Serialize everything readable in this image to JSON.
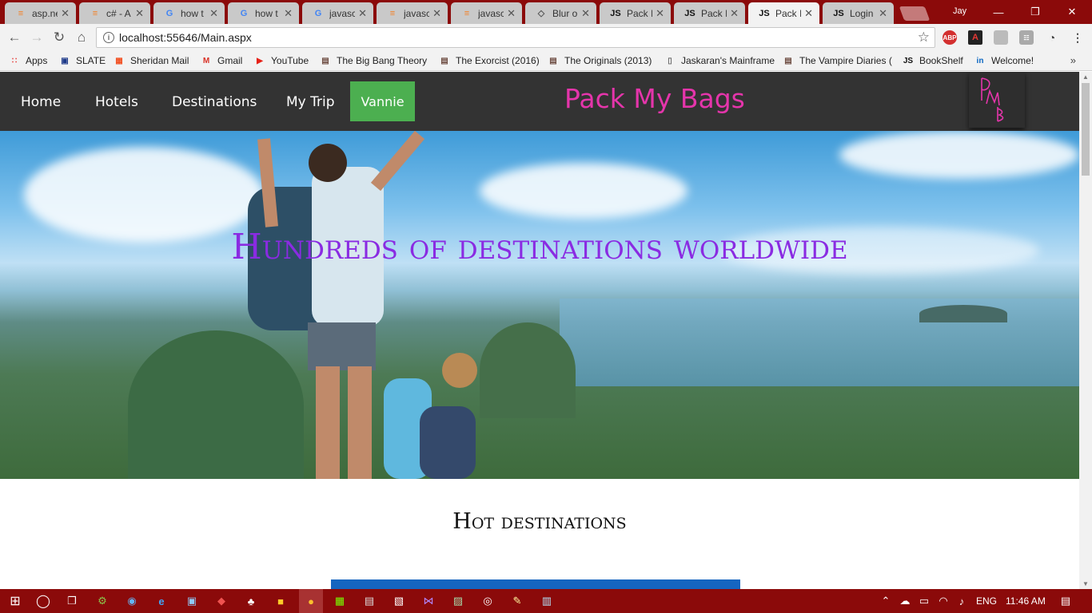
{
  "browser": {
    "tabs": [
      {
        "title": "asp.ne",
        "icon": "stackoverflow-icon"
      },
      {
        "title": "c# - A",
        "icon": "stackoverflow-icon"
      },
      {
        "title": "how t",
        "icon": "google-icon"
      },
      {
        "title": "how t",
        "icon": "google-icon"
      },
      {
        "title": "javasc",
        "icon": "google-icon"
      },
      {
        "title": "javasc",
        "icon": "stackoverflow-icon"
      },
      {
        "title": "javasc",
        "icon": "stackoverflow-icon"
      },
      {
        "title": "Blur o",
        "icon": "codepen-icon"
      },
      {
        "title": "Pack I",
        "icon": "js-icon"
      },
      {
        "title": "Pack I",
        "icon": "js-icon"
      },
      {
        "title": "Pack I",
        "icon": "js-icon"
      },
      {
        "title": "Login",
        "icon": "js-icon"
      }
    ],
    "active_tab_index": 10,
    "user": "Jay",
    "address": "localhost:55646/Main.aspx",
    "bookmarks": [
      {
        "label": "Apps",
        "icon": "apps-icon"
      },
      {
        "label": "SLATE",
        "icon": "slate-icon"
      },
      {
        "label": "Sheridan Mail",
        "icon": "microsoft-icon"
      },
      {
        "label": "Gmail",
        "icon": "gmail-icon"
      },
      {
        "label": "YouTube",
        "icon": "youtube-icon"
      },
      {
        "label": "The Big Bang Theory",
        "icon": "film-icon"
      },
      {
        "label": "The Exorcist (2016)",
        "icon": "film-icon"
      },
      {
        "label": "The Originals (2013)",
        "icon": "film-icon"
      },
      {
        "label": "Jaskaran's Mainframe",
        "icon": "page-icon"
      },
      {
        "label": "The Vampire Diaries (",
        "icon": "film-icon"
      },
      {
        "label": "BookShelf",
        "icon": "js-icon"
      },
      {
        "label": "Welcome!",
        "icon": "linkedin-icon"
      }
    ],
    "bookmarks_more": "»"
  },
  "site": {
    "nav": {
      "home": "Home",
      "hotels": "Hotels",
      "destinations": "Destinations",
      "my_trip": "My Trip",
      "user_button": "Vannie"
    },
    "brand": "Pack My Bags",
    "hero_headline": "Hundreds of destinations worldwide",
    "section_title": "Hot destinations",
    "colors": {
      "nav_bg": "#333333",
      "brand": "#e535ab",
      "user_button": "#4caf50",
      "headline": "#8a2be2",
      "card": "#1565c0"
    }
  },
  "taskbar": {
    "language": "ENG",
    "time": "11:46 AM"
  }
}
